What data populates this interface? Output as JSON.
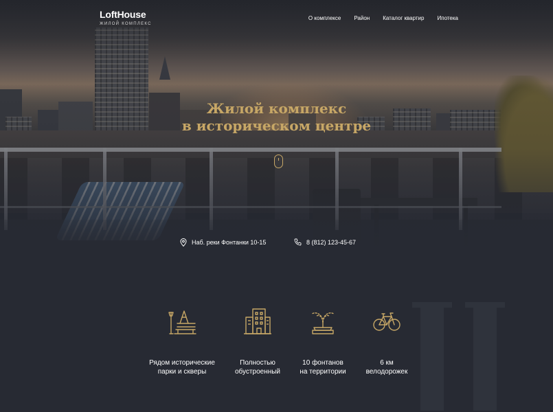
{
  "header": {
    "logo_title": "LoftHouse",
    "logo_subtitle": "ЖИЛОЙ КОМПЛЕКС",
    "nav": [
      {
        "label": "О комплексе"
      },
      {
        "label": "Район"
      },
      {
        "label": "Каталог квартир"
      },
      {
        "label": "Ипотека"
      }
    ]
  },
  "hero": {
    "title_line1": "Жилой комплекс",
    "title_line2": "в историческом центре",
    "scroll_icon": "mouse-scroll-icon"
  },
  "contacts": {
    "address": "Наб. реки Фонтанки 10-15",
    "address_icon": "map-pin-icon",
    "phone": "8 (812) 123-45-67",
    "phone_icon": "phone-icon"
  },
  "features": [
    {
      "icon": "park-bench-icon",
      "line1": "Рядом исторические",
      "line2": "парки и скверы"
    },
    {
      "icon": "buildings-icon",
      "line1": "Полностью",
      "line2": "обустроенный"
    },
    {
      "icon": "fountain-icon",
      "line1": "10 фонтанов",
      "line2": "на территории"
    },
    {
      "icon": "bicycle-icon",
      "line1": "6 км",
      "line2": "велодорожек"
    }
  ],
  "colors": {
    "accent_gold": "#c7a766",
    "background": "#272a33",
    "text": "#ffffff"
  }
}
